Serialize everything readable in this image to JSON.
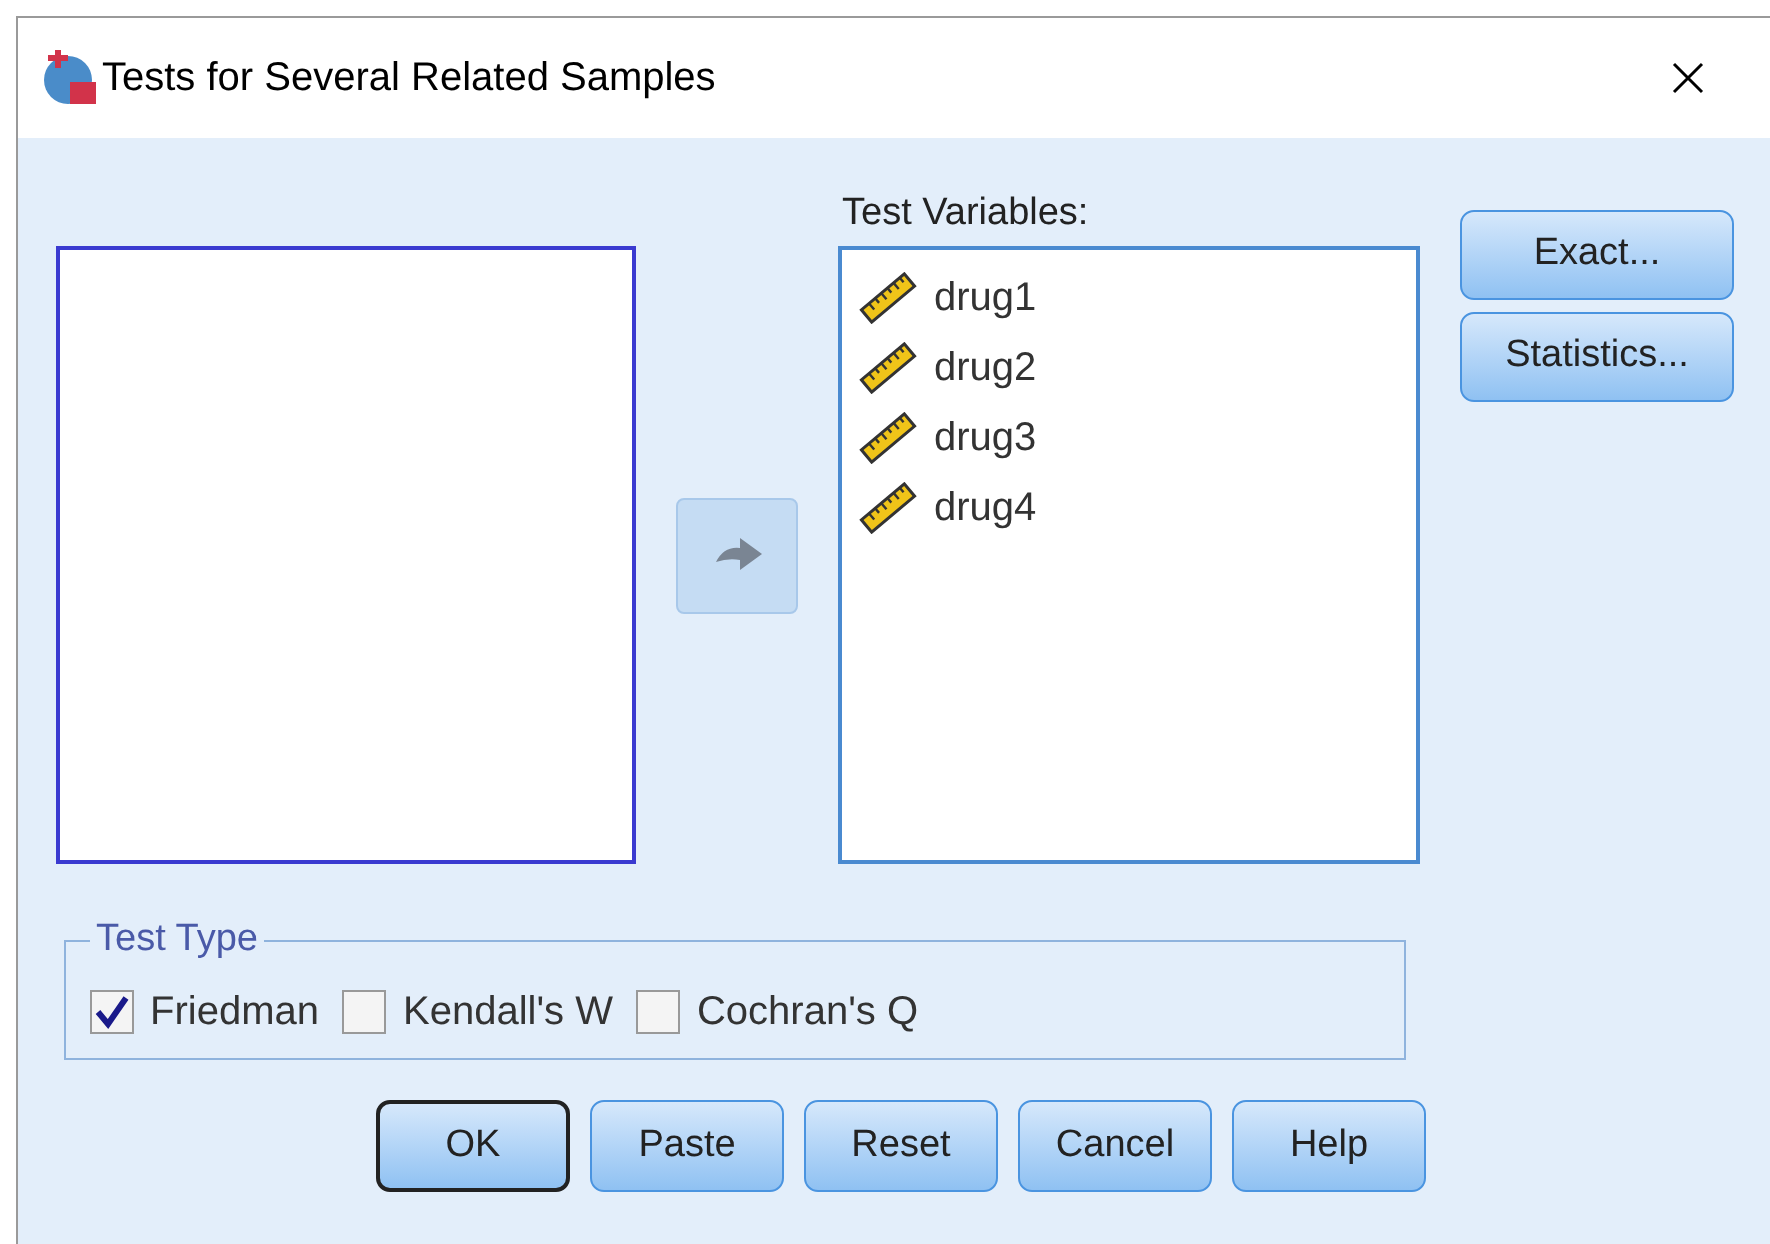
{
  "window": {
    "title": "Tests for Several Related Samples"
  },
  "test_variables": {
    "label": "Test Variables:",
    "items": [
      {
        "name": "drug1"
      },
      {
        "name": "drug2"
      },
      {
        "name": "drug3"
      },
      {
        "name": "drug4"
      }
    ]
  },
  "side_buttons": [
    {
      "label": "Exact..."
    },
    {
      "label": "Statistics..."
    }
  ],
  "test_type": {
    "title": "Test Type",
    "options": [
      {
        "label": "Friedman",
        "checked": true
      },
      {
        "label": "Kendall's W",
        "checked": false
      },
      {
        "label": "Cochran's Q",
        "checked": false
      }
    ]
  },
  "buttons": [
    {
      "label": "OK",
      "default": true
    },
    {
      "label": "Paste",
      "default": false
    },
    {
      "label": "Reset",
      "default": false
    },
    {
      "label": "Cancel",
      "default": false
    },
    {
      "label": "Help",
      "default": false
    }
  ]
}
